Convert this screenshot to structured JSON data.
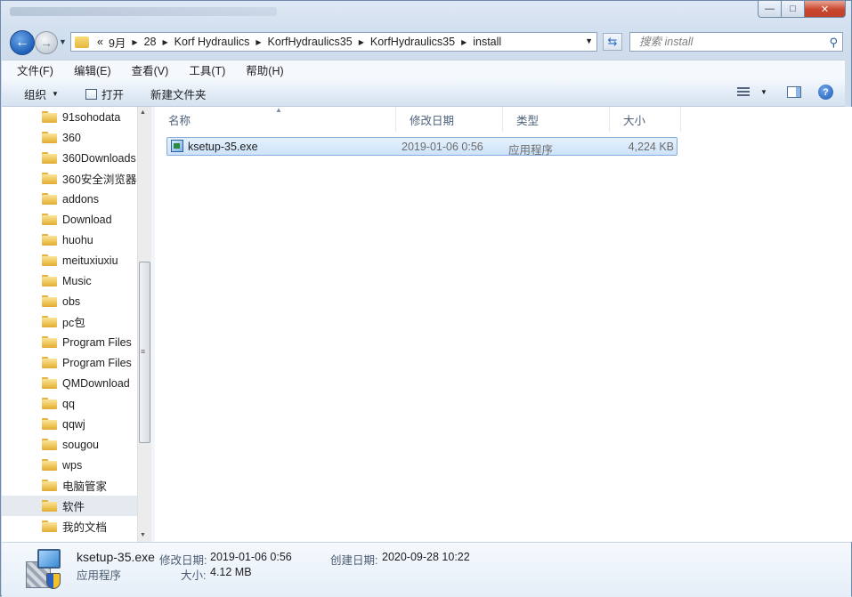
{
  "window": {
    "controls": {
      "minimize": "—",
      "maximize": "□",
      "close": "✕"
    }
  },
  "nav": {
    "back_glyph": "←",
    "forward_glyph": "→",
    "breadcrumbs": [
      "«",
      "9月",
      "28",
      "Korf Hydraulics",
      "KorfHydraulics35",
      "KorfHydraulics35",
      "install"
    ],
    "search_placeholder": "搜索 install"
  },
  "menubar": {
    "items": [
      "文件(F)",
      "编辑(E)",
      "查看(V)",
      "工具(T)",
      "帮助(H)"
    ]
  },
  "toolbar": {
    "organize": "组织",
    "open": "打开",
    "new_folder": "新建文件夹"
  },
  "sidebar": {
    "items": [
      "91sohodata",
      "360",
      "360Downloads",
      "360安全浏览器",
      "addons",
      "Download",
      "huohu",
      "meituxiuxiu",
      "Music",
      "obs",
      "pc包",
      "Program Files",
      "Program Files",
      "QMDownload",
      "qq",
      "qqwj",
      "sougou",
      "wps",
      "电脑管家",
      "软件",
      "我的文档"
    ],
    "selected_index": 19
  },
  "columns": {
    "name": "名称",
    "modified": "修改日期",
    "type": "类型",
    "size": "大小"
  },
  "files": [
    {
      "name": "ksetup-35.exe",
      "modified": "2019-01-06 0:56",
      "type": "应用程序",
      "size": "4,224 KB",
      "icon": "installer-exe-icon"
    }
  ],
  "details": {
    "name": "ksetup-35.exe",
    "type": "应用程序",
    "modified_label": "修改日期:",
    "modified": "2019-01-06 0:56",
    "size_label": "大小:",
    "size": "4.12 MB",
    "created_label": "创建日期:",
    "created": "2020-09-28 10:22",
    "icon": "installer-icon"
  },
  "colors": {
    "accent": "#1f5fb8",
    "selection": "#cde3f9",
    "folder": "#eec455"
  }
}
